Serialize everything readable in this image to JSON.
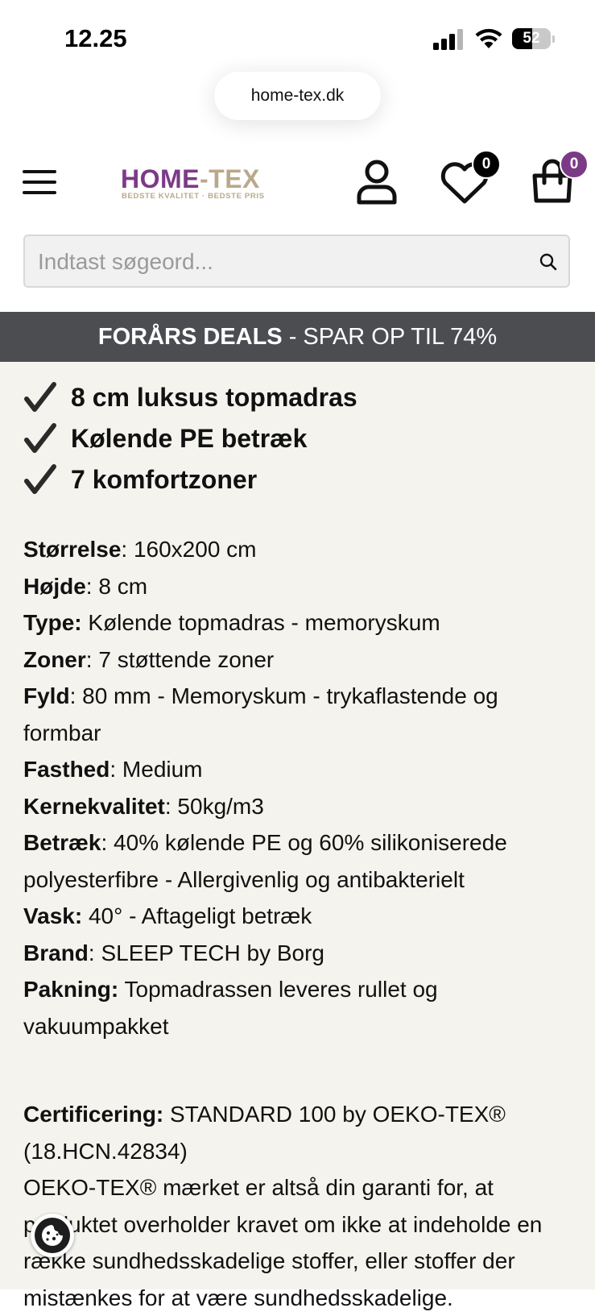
{
  "status_bar": {
    "time": "12.25",
    "battery": "52",
    "battery_level": 0.52
  },
  "browser": {
    "url": "home-tex.dk"
  },
  "header": {
    "logo": {
      "home": "HOME",
      "dash": "-",
      "tex": "TEX",
      "tagline": "BEDSTE KVALITET · BEDSTE PRIS"
    },
    "wishlist_count": "0",
    "cart_count": "0",
    "icons": {
      "menu": "hamburger-icon",
      "account": "user-icon",
      "wishlist": "heart-icon",
      "cart": "shopping-bag-icon"
    }
  },
  "search": {
    "placeholder": "Indtast søgeord..."
  },
  "promo": {
    "strong": "FORÅRS DEALS",
    "rest": " - SPAR OP TIL 74%"
  },
  "features": [
    "8 cm luksus topmadras",
    "Kølende PE betræk",
    "7 komfortzoner"
  ],
  "specs": [
    {
      "label": "Størrelse",
      "value": ": 160x200 cm"
    },
    {
      "label": "Højde",
      "value": ": 8 cm"
    },
    {
      "label": "Type:",
      "value": " Kølende topmadras - memoryskum"
    },
    {
      "label": "Zoner",
      "value": ": 7 støttende zoner"
    },
    {
      "label": "Fyld",
      "value": ": 80 mm - Memoryskum - trykaflastende og formbar"
    },
    {
      "label": "Fasthed",
      "value": ": Medium"
    },
    {
      "label": "Kernekvalitet",
      "value": ": 50kg/m3"
    },
    {
      "label": "Betræk",
      "value": ": 40% kølende PE og 60% silikoniserede polyesterfibre - Allergivenlig og antibakterielt"
    },
    {
      "label": "Vask:",
      "value": " 40° - Aftageligt betræk"
    },
    {
      "label": "Brand",
      "value": ": SLEEP TECH by Borg"
    },
    {
      "label": "Pakning:",
      "value": " Topmadrassen leveres rullet og vakuumpakket"
    }
  ],
  "certification": {
    "label": "Certificering:",
    "value": " STANDARD 100 by OEKO-TEX® (18.HCN.42834)",
    "text": "OEKO-TEX® mærket er altså din garanti for, at produktet overholder kravet om ikke at indeholde en række sundhedsskadelige stoffer, eller stoffer der mistænkes for at være sundhedsskadelige."
  },
  "colors": {
    "brand_purple": "#7b3a88",
    "brand_gold": "#b9a98a",
    "banner": "#4b4d50",
    "content_bg": "#f4f3ed"
  }
}
